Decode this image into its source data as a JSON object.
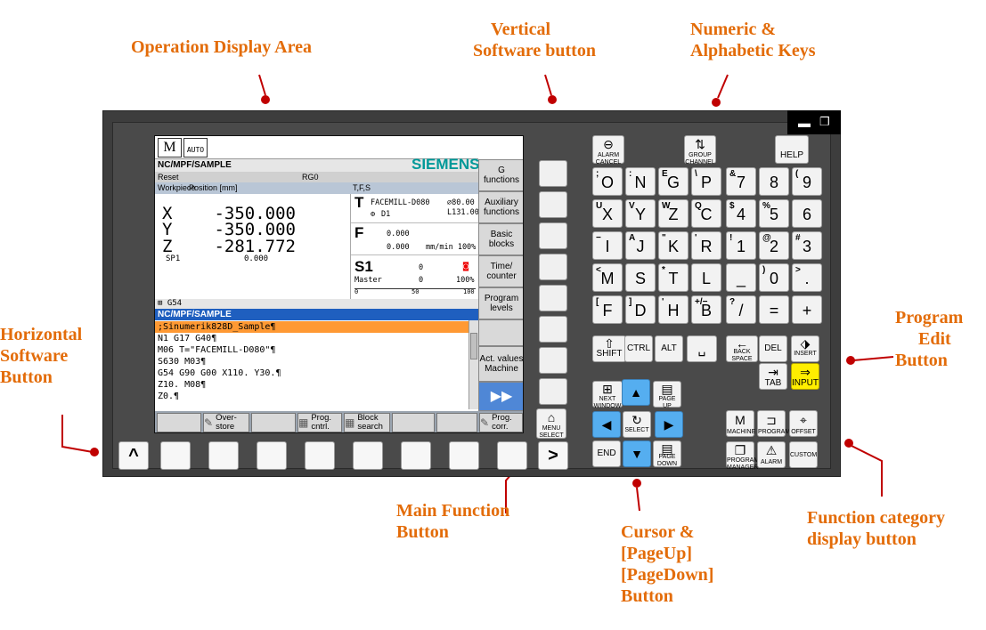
{
  "callouts": {
    "operation_display": "Operation Display Area",
    "vertical_softkey": [
      "Vertical",
      "Software button"
    ],
    "numeric_alpha": [
      "Numeric &",
      "Alphabetic Keys"
    ],
    "horizontal_softkey": [
      "Horizontal",
      "Software",
      "Button"
    ],
    "program_edit": [
      "Program",
      "Edit",
      "Button"
    ],
    "main_function": [
      "Main Function",
      "Button"
    ],
    "cursor": [
      "Cursor &",
      "[PageUp]",
      "[PageDown]",
      "Button"
    ],
    "function_category": [
      "Function category",
      "display button"
    ]
  },
  "colors": {
    "callout": "#e36c09",
    "panel": "#3d3d3d",
    "brand": "#009999",
    "highlight": "#ff9933",
    "program_header": "#1f5fbf",
    "cursor_keys": "#55aef0",
    "input_key": "#ffee00"
  },
  "screen": {
    "mode_icons": [
      "M",
      "AUTO"
    ],
    "path": "NC/MPF/SAMPLE",
    "brand": "SIEMENS",
    "reset": "Reset",
    "rg": "RG0",
    "hdr_workpiece": "Workpiece",
    "hdr_position": "Position [mm]",
    "hdr_tfs": "T,F,S",
    "axes": [
      {
        "name": "X",
        "value": "-350.000"
      },
      {
        "name": "Y",
        "value": "-350.000"
      },
      {
        "name": "Z",
        "value": "-281.772"
      }
    ],
    "sp1": "SP1",
    "sp1_value": "0.000",
    "tool": {
      "letter": "T",
      "name": "FACEMILL-D080",
      "dia": "⌀80.00",
      "length": "L131.00",
      "d": "D1"
    },
    "feed": {
      "letter": "F",
      "v1": "0.000",
      "v2": "0.000",
      "unit": "mm/min 100%"
    },
    "spindle": {
      "letter": "S1",
      "v1": "0",
      "master": "Master",
      "v2": "0",
      "pct": "100%",
      "scale_0": "0",
      "scale_50": "50",
      "scale_100": "100"
    },
    "g54": "G54",
    "program_header": "NC/MPF/SAMPLE",
    "code_lines": [
      ";Sinumerik828D_Sample¶",
      "N1 G17 G40¶",
      "M06 T=\"FACEMILL-D080\"¶",
      "S630 M03¶",
      "G54 G90 G00 X110. Y30.¶",
      "Z10. M08¶",
      "Z0.¶"
    ],
    "vertical_softkeys": [
      "G functions",
      "Auxiliary functions",
      "Basic blocks",
      "Time/ counter",
      "Program levels",
      "",
      "Act. values Machine",
      "▶▶"
    ],
    "horizontal_softkeys": [
      "",
      "Over- store",
      "",
      "Prog. cntrl.",
      "Block search",
      "",
      "",
      "Prog. corr."
    ]
  },
  "keys": {
    "alarm_cancel": "ALARM CANCEL",
    "group_channel": "GROUP CHANNEL",
    "help": "HELP",
    "alpha": [
      {
        "sub": ";",
        "main": "O"
      },
      {
        "sub": ":",
        "main": "N"
      },
      {
        "sub": "E",
        "main": "G"
      },
      {
        "sub": "\\",
        "main": "P"
      },
      {
        "sub": "U",
        "main": "X"
      },
      {
        "sub": "V",
        "main": "Y"
      },
      {
        "sub": "W",
        "main": "Z"
      },
      {
        "sub": "Q",
        "main": "C"
      },
      {
        "sub": "−",
        "main": "I"
      },
      {
        "sub": "A",
        "main": "J"
      },
      {
        "sub": "\"",
        "main": "K"
      },
      {
        "sub": "'",
        "main": "R"
      },
      {
        "sub": "<",
        "main": "M"
      },
      {
        "sub": "",
        "main": "S"
      },
      {
        "sub": "*",
        "main": "T"
      },
      {
        "sub": "",
        "main": "L"
      },
      {
        "sub": "[",
        "main": "F"
      },
      {
        "sub": "]",
        "main": "D"
      },
      {
        "sub": "'",
        "main": "H"
      },
      {
        "sub": "+/−",
        "main": "B"
      }
    ],
    "numeric": [
      {
        "sub": "&",
        "main": "7"
      },
      {
        "sub": "",
        "main": "8"
      },
      {
        "sub": "(",
        "main": "9"
      },
      {
        "sub": "$",
        "main": "4"
      },
      {
        "sub": "%",
        "main": "5"
      },
      {
        "sub": "",
        "main": "6"
      },
      {
        "sub": "!",
        "main": "1"
      },
      {
        "sub": "@",
        "main": "2"
      },
      {
        "sub": "#",
        "main": "3"
      },
      {
        "sub": "",
        "main": "_"
      },
      {
        "sub": ")",
        "main": "0"
      },
      {
        "sub": ">",
        "main": "."
      },
      {
        "sub": "?",
        "main": "/"
      },
      {
        "sub": "",
        "main": "="
      },
      {
        "sub": "",
        "main": "+"
      }
    ],
    "shift": "SHIFT",
    "ctrl": "CTRL",
    "alt": "ALT",
    "space": "␣",
    "backspace": "BACK SPACE",
    "del": "DEL",
    "insert": "INSERT",
    "tab": "TAB",
    "input": "INPUT",
    "next_window": "NEXT WINDOW",
    "page_up": "PAGE UP",
    "select": "SELECT",
    "end": "END",
    "page_down": "PAGE DOWN",
    "menu_select": "MENU SELECT",
    "machine": "MACHINE",
    "program": "PROGRAM",
    "offset": "OFFSET",
    "program_manager": "PROGRAM MANAGER",
    "alarm": "ALARM",
    "custom": "CUSTOM",
    "h_left": "^",
    "h_right": ">"
  }
}
